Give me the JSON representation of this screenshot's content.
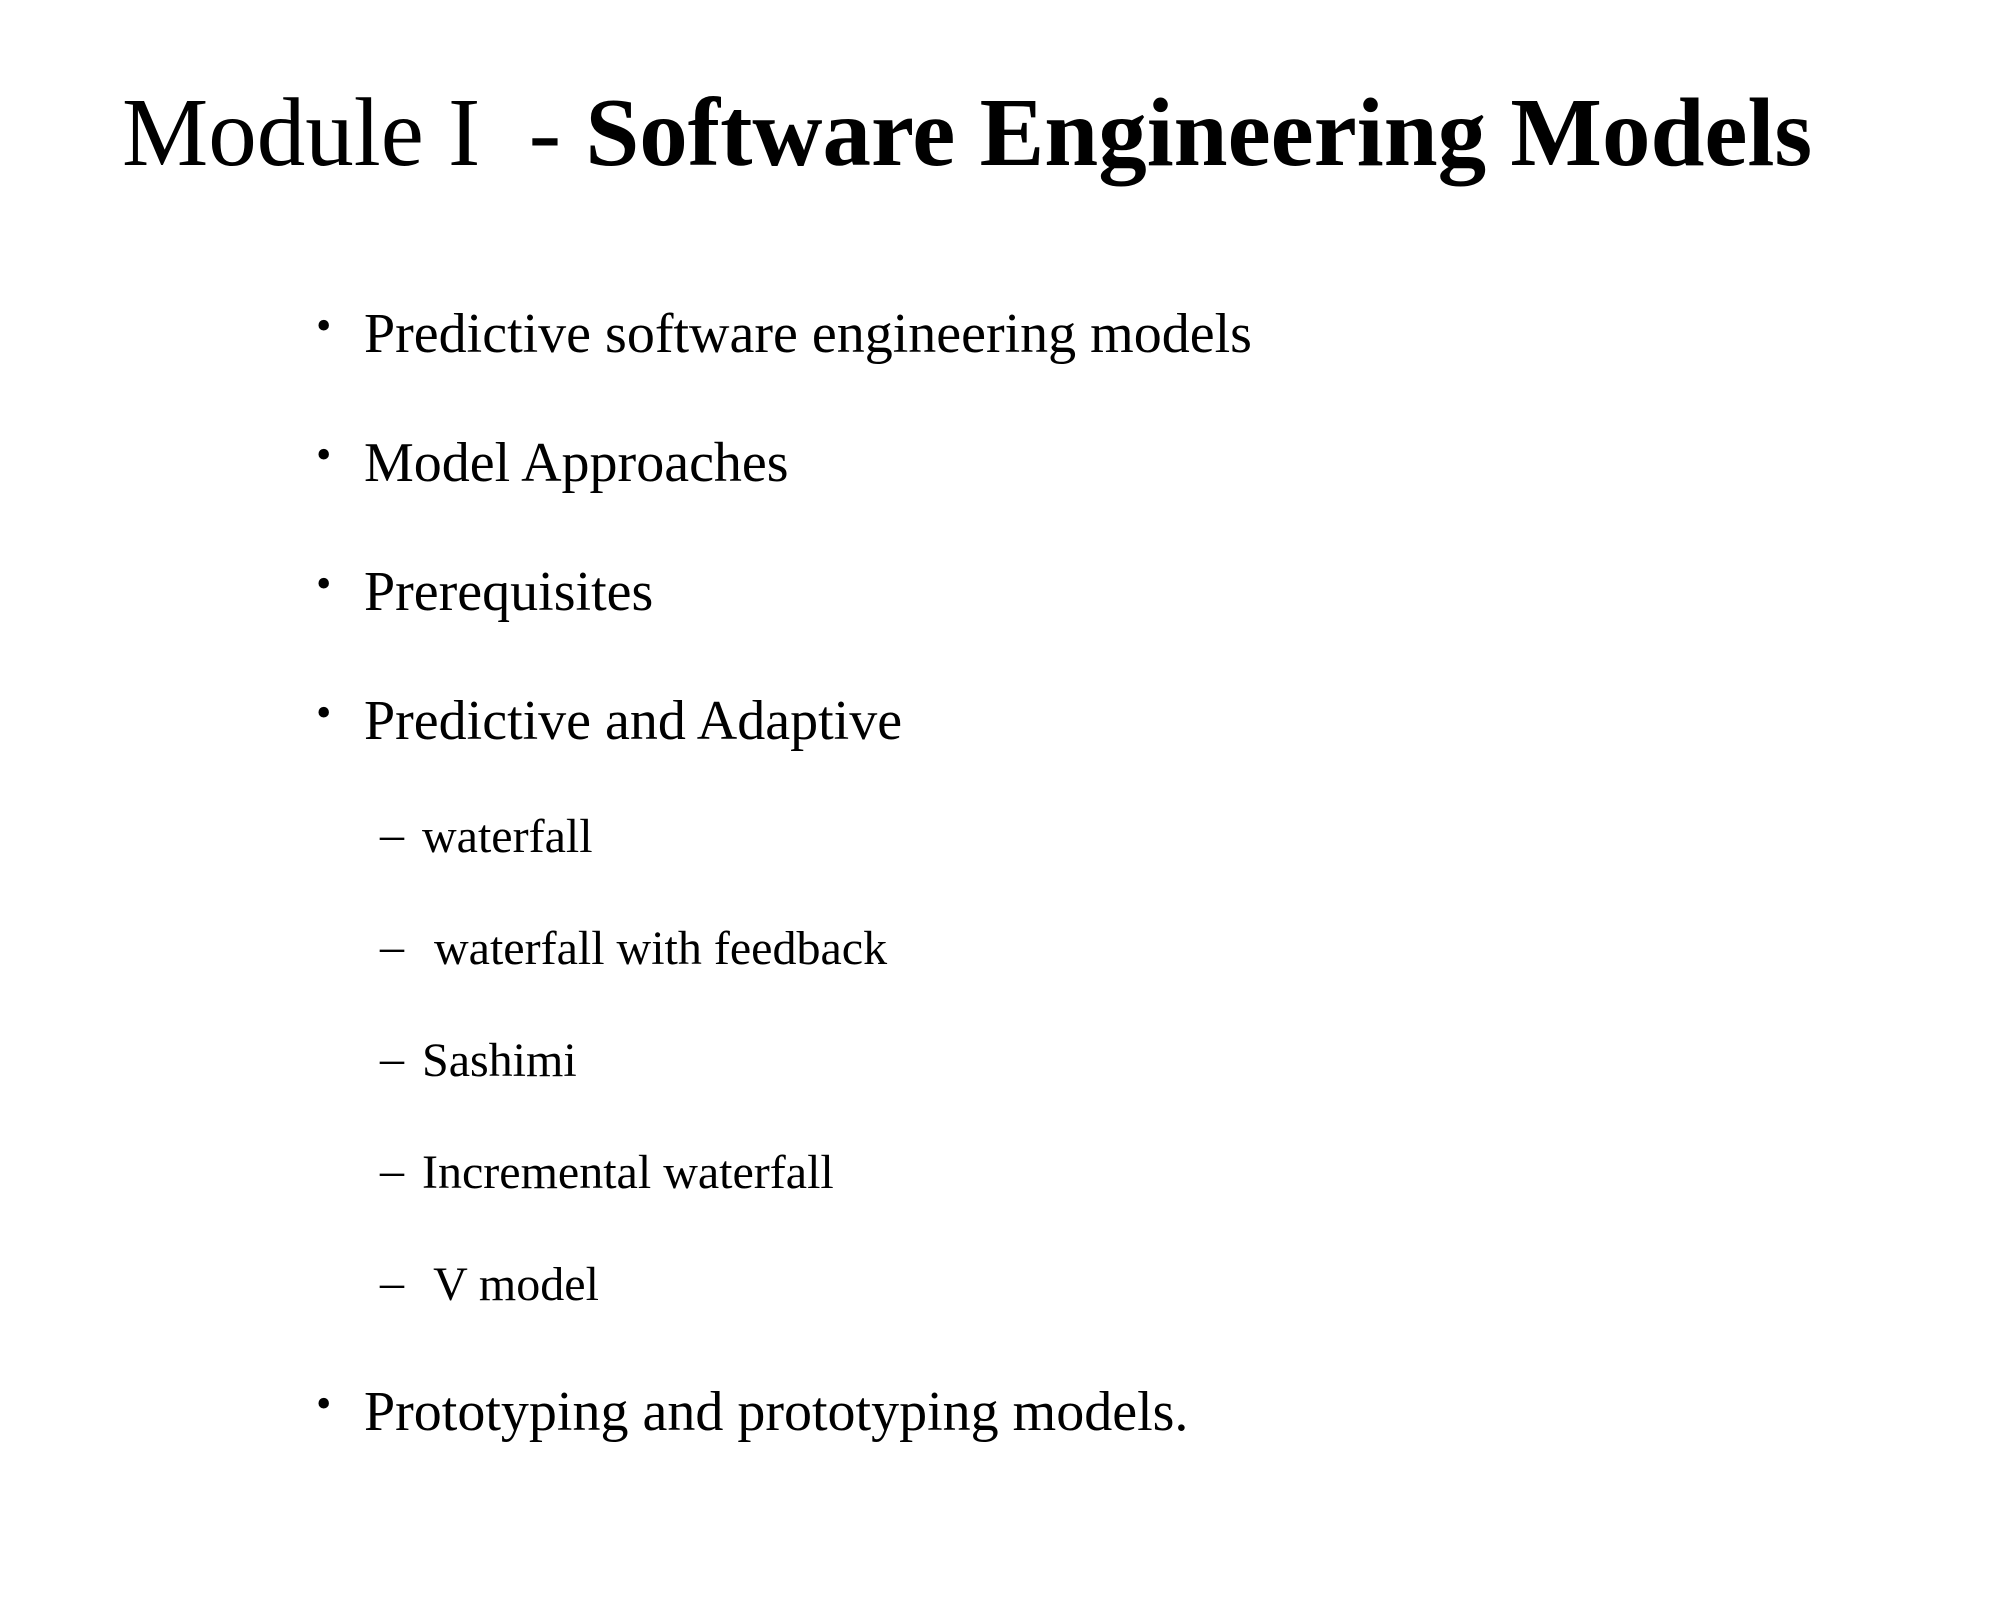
{
  "slide": {
    "title_prefix": "Module I  - ",
    "title_strong": "Software Engineering Models",
    "bullet_symbol": "•",
    "sub_bullet_symbol": "–",
    "bullets": [
      "Predictive software engineering models",
      "Model Approaches",
      "Prerequisites",
      "Predictive and Adaptive"
    ],
    "sub_bullets": [
      "waterfall",
      " waterfall with feedback",
      "Sashimi",
      "Incremental waterfall",
      " V model"
    ],
    "last_bullet": "Prototyping and prototyping models."
  }
}
